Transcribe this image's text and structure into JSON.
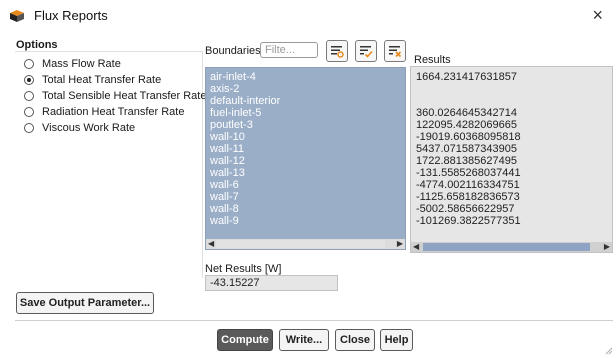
{
  "window": {
    "title": "Flux Reports",
    "icon": "flux-app-icon",
    "close_label": "×"
  },
  "options": {
    "label": "Options",
    "items": [
      {
        "label": "Mass Flow Rate",
        "checked": false
      },
      {
        "label": "Total Heat Transfer Rate",
        "checked": true
      },
      {
        "label": "Total Sensible Heat Transfer Rate",
        "checked": false
      },
      {
        "label": "Radiation Heat Transfer Rate",
        "checked": false
      },
      {
        "label": "Viscous Work Rate",
        "checked": false
      }
    ]
  },
  "boundaries": {
    "label": "Boundaries",
    "filter_placeholder": "Filte...",
    "items": [
      "air-inlet-4",
      "axis-2",
      "default-interior",
      "fuel-inlet-5",
      "poutlet-3",
      "wall-10",
      "wall-11",
      "wall-12",
      "wall-13",
      "wall-6",
      "wall-7",
      "wall-8",
      "wall-9"
    ]
  },
  "results": {
    "label": "Results",
    "values": [
      "1664.231417631857",
      "",
      "",
      "360.0264645342714",
      "122095.4282069665",
      "-19019.60368095818",
      "5437.071587343905",
      "1722.881385627495",
      "-131.5585268037441",
      "-4774.002116334751",
      "-1125.658182836573",
      "-5002.58656622957",
      "-101269.3822577351"
    ]
  },
  "net_results": {
    "label": "Net Results [W]",
    "value": "-43.15227"
  },
  "buttons": {
    "save_output": "Save Output Parameter...",
    "compute": "Compute",
    "write": "Write...",
    "close": "Close",
    "help": "Help"
  },
  "colors": {
    "selection": "#9aaec8",
    "primary_button": "#5a5a5a",
    "accent_orange": "#e8891c"
  }
}
